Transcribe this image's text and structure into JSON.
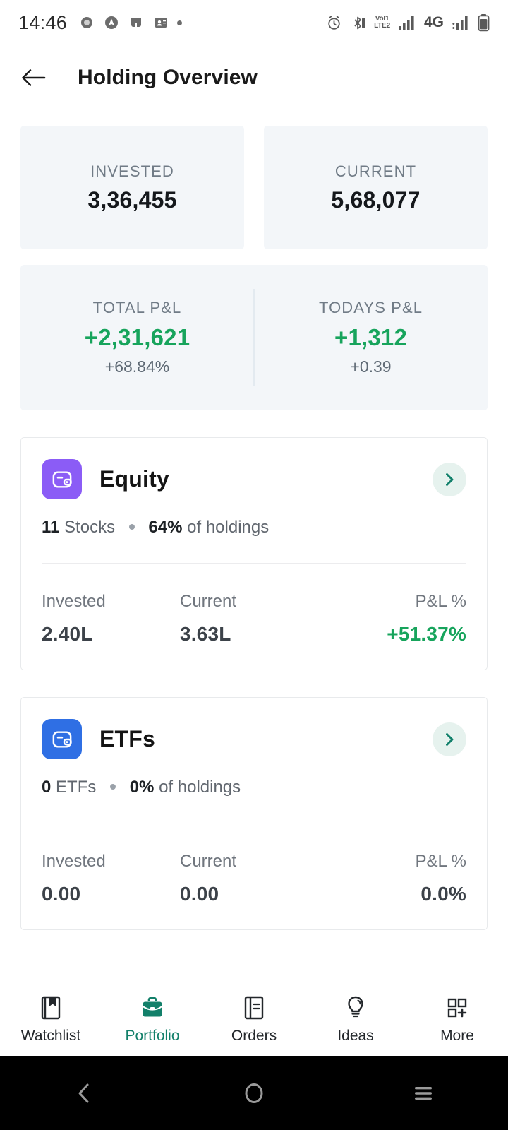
{
  "status_bar": {
    "time": "14:46",
    "left_icons": [
      "camera-icon",
      "android-auto-icon",
      "app-icon",
      "contacts-icon",
      "dot-icon"
    ],
    "right_icons": [
      "alarm-icon",
      "bluetooth-icon",
      "volte-icon",
      "signal-bars-icon",
      "4g-icon",
      "signal-bars-2-icon",
      "battery-icon"
    ],
    "volte_top": "VoI1",
    "volte_bottom": "LTE2",
    "network_type": "4G"
  },
  "appbar": {
    "back_icon": "back-arrow-icon",
    "title": "Holding Overview"
  },
  "summary": {
    "invested": {
      "label": "INVESTED",
      "value": "3,36,455"
    },
    "current": {
      "label": "CURRENT",
      "value": "5,68,077"
    },
    "total_pnl": {
      "label": "TOTAL P&L",
      "value": "+2,31,621",
      "sub": "+68.84%"
    },
    "todays_pnl": {
      "label": "TODAYS P&L",
      "value": "+1,312",
      "sub": "+0.39"
    }
  },
  "assets": [
    {
      "title": "Equity",
      "icon": "wallet-icon",
      "icon_color": "#8b5cf6",
      "count": "11",
      "count_unit": "Stocks",
      "pct": "64%",
      "pct_suffix": "of holdings",
      "chevron_icon": "chevron-right-icon",
      "stats": [
        {
          "label": "Invested",
          "value": "2.40L",
          "state": "neutral"
        },
        {
          "label": "Current",
          "value": "3.63L",
          "state": "neutral"
        },
        {
          "label": "P&L %",
          "value": "+51.37%",
          "state": "positive"
        }
      ]
    },
    {
      "title": "ETFs",
      "icon": "wallet-icon",
      "icon_color": "#2f6fe4",
      "count": "0",
      "count_unit": "ETFs",
      "pct": "0%",
      "pct_suffix": "of holdings",
      "chevron_icon": "chevron-right-icon",
      "stats": [
        {
          "label": "Invested",
          "value": "0.00",
          "state": "neutral"
        },
        {
          "label": "Current",
          "value": "0.00",
          "state": "neutral"
        },
        {
          "label": "P&L %",
          "value": "0.0%",
          "state": "neutral"
        }
      ]
    }
  ],
  "bottom_nav": {
    "active_index": 1,
    "items": [
      {
        "label": "Watchlist",
        "icon": "bookmark-book-icon"
      },
      {
        "label": "Portfolio",
        "icon": "briefcase-icon"
      },
      {
        "label": "Orders",
        "icon": "notebook-icon"
      },
      {
        "label": "Ideas",
        "icon": "lightbulb-icon"
      },
      {
        "label": "More",
        "icon": "grid-plus-icon"
      }
    ]
  },
  "system_nav": {
    "back": "system-back-icon",
    "home": "system-home-icon",
    "recents": "system-recents-icon"
  },
  "colors": {
    "positive": "#17a45c",
    "accent_teal": "#13806a",
    "tile_bg": "#f3f6f9",
    "equity_purple": "#8b5cf6",
    "etf_blue": "#2f6fe4"
  }
}
